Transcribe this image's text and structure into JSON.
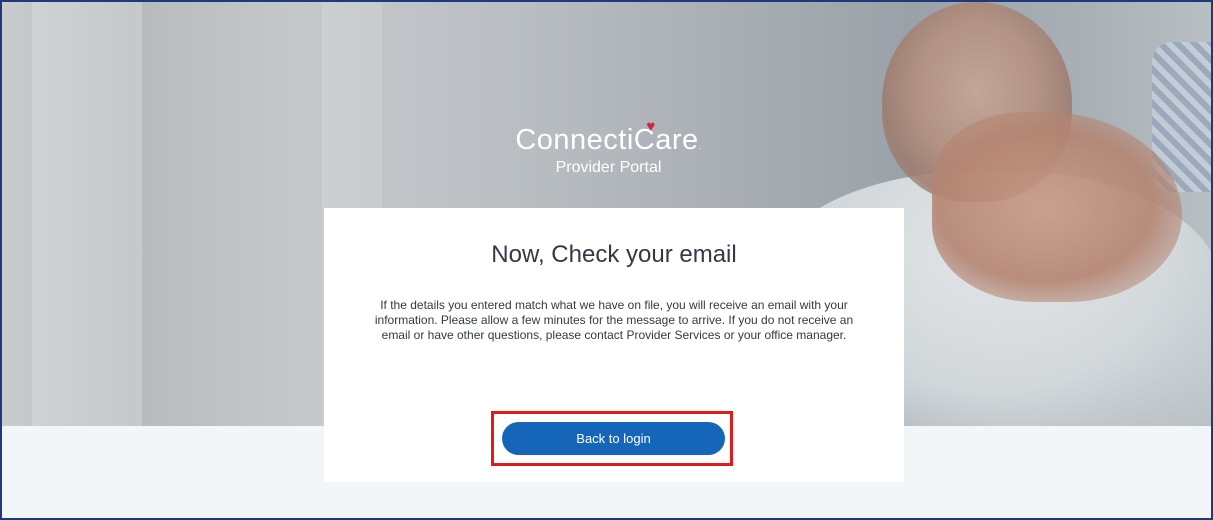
{
  "brand": {
    "logo_text": "ConnectiCare",
    "subtitle": "Provider Portal"
  },
  "card": {
    "title": "Now, Check your email",
    "message": "If the details you entered match what we have on file, you will receive an email with your information. Please allow a few minutes for the message to arrive. If you do not receive an email or have other questions, please contact Provider Services or your office manager.",
    "button_label": "Back to login"
  },
  "colors": {
    "button": "#1565b8",
    "highlight": "#e01b1b",
    "heart": "#d2233c",
    "frame_border": "#1f3a78"
  }
}
